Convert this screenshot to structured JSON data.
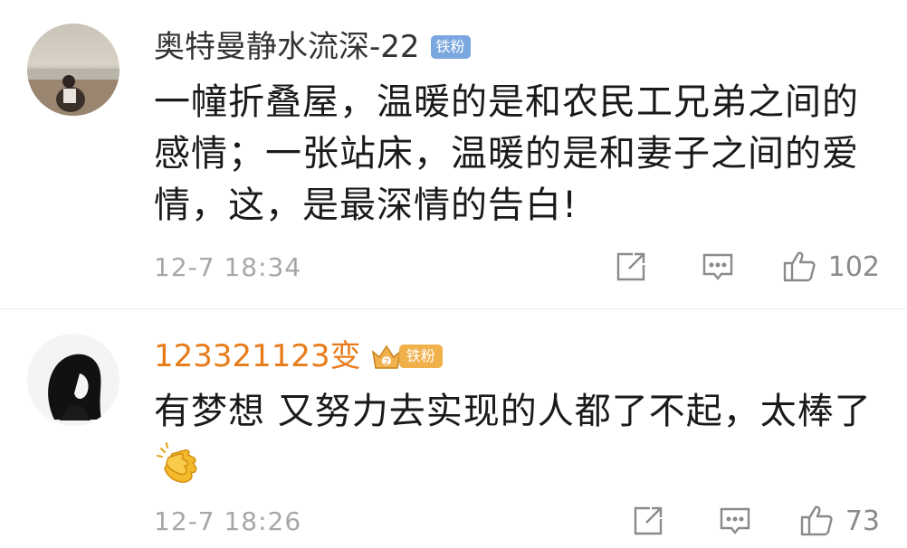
{
  "comments": [
    {
      "username": "奥特曼静水流深-22",
      "badge": "铁粉",
      "content": "一幢折叠屋，温暖的是和农民工兄弟之间的感情；一张站床，温暖的是和妻子之间的爱情，这，是最深情的告白!",
      "time": "12-7 18:34",
      "likes": "102"
    },
    {
      "username": "123321123变",
      "badge": "铁粉",
      "content": "有梦想 又努力去实现的人都了不起，太棒了",
      "time": "12-7 18:26",
      "likes": "73"
    }
  ],
  "icons": {
    "share": "share-icon",
    "reply": "comment-icon",
    "like": "thumbs-up-icon",
    "clap": "clapping-hands-icon",
    "crown": "crown-icon"
  },
  "colors": {
    "username_first": "#333333",
    "username_second": "#e87b1a",
    "badge_blue": "#7aa7df",
    "badge_gold": "#f0b04a",
    "meta_gray": "#a7a7a7"
  }
}
